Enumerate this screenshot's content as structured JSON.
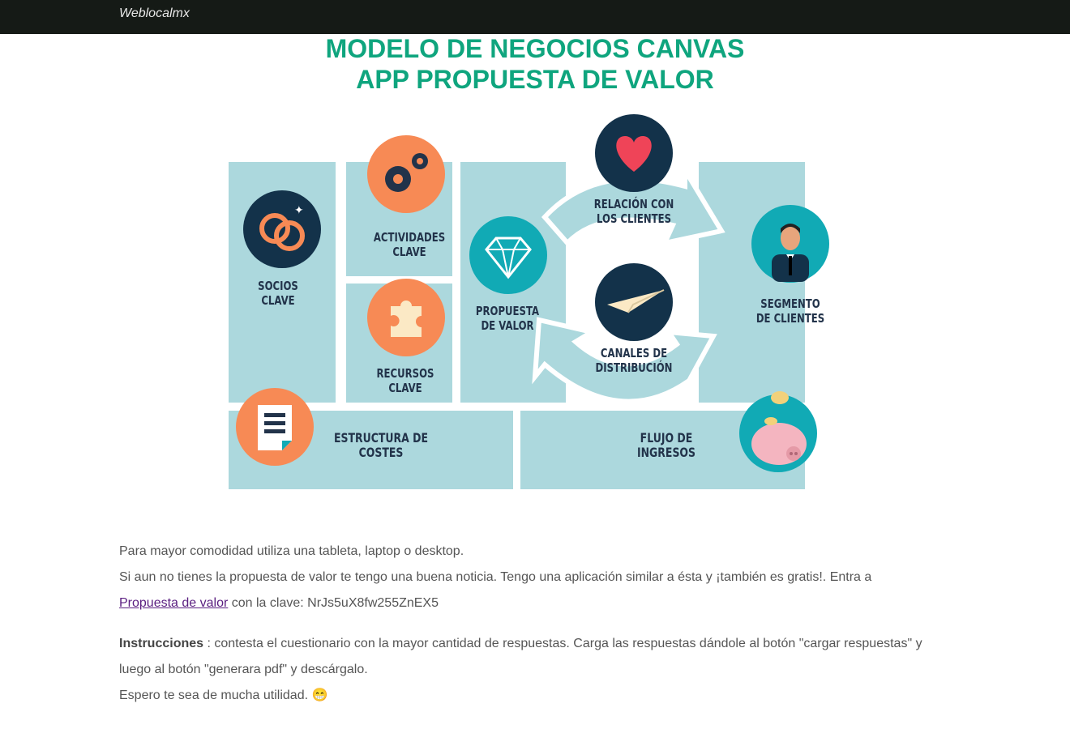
{
  "navbar": {
    "brand": "Weblocalmx"
  },
  "header": {
    "title_line1": "MODELO DE NEGOCIOS CANVAS",
    "title_line2": "APP PROPUESTA DE VALOR"
  },
  "canvas": {
    "socios": "SOCIOS\nCLAVE",
    "actividades": "ACTIVIDADES\nCLAVE",
    "recursos": "RECURSOS\nCLAVE",
    "propuesta": "PROPUESTA\nDE VALOR",
    "relacion": "RELACIÓN CON\nLOS CLIENTES",
    "canales": "CANALES DE\nDISTRIBUCIÓN",
    "segmento": "SEGMENTO\nDE CLIENTES",
    "costes": "ESTRUCTURA DE COSTES",
    "ingresos": "FLUJO DE INGRESOS",
    "colors": {
      "block": "#acd8dd",
      "dark_circle": "#13324a",
      "orange_circle": "#f78a55",
      "teal_circle": "#11aab5"
    }
  },
  "content": {
    "line1": "Para mayor comodidad utiliza una tableta, laptop o desktop.",
    "line2": "Si aun no tienes la propuesta de valor te tengo una buena noticia. Tengo una aplicación similar a ésta y ¡también es gratis!. Entra a",
    "link_text": "Propuesta de valor",
    "clave_text": " con la clave: NrJs5uX8fw255ZnEX5",
    "instr_label": "Instrucciones",
    "instr_text": " : contesta el cuestionario con la mayor cantidad de respuestas. Carga las respuestas dándole al botón \"cargar respuestas\" y luego al botón \"generara pdf\" y descárgalo.",
    "closing": "Espero te sea de mucha utilidad. 😁"
  }
}
